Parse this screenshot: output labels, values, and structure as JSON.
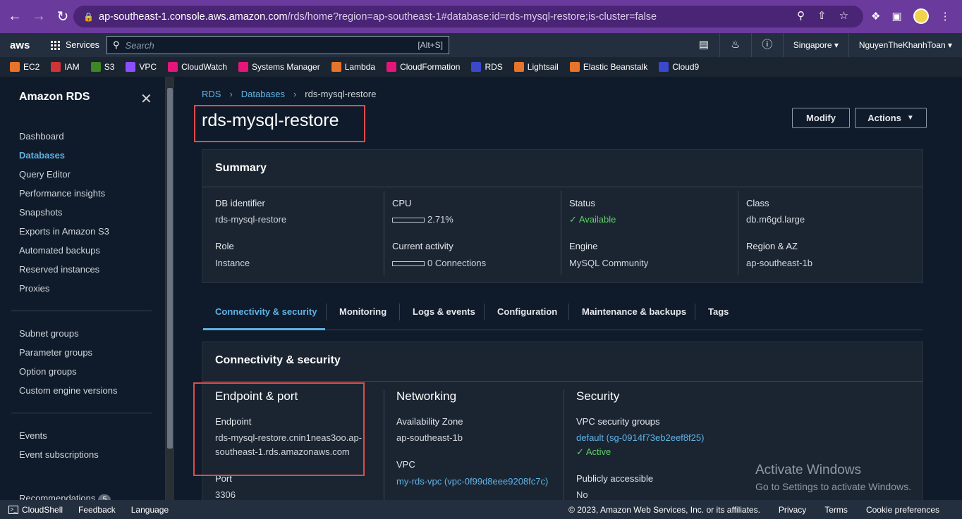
{
  "browser": {
    "url_domain": "ap-southeast-1.console.aws.amazon.com",
    "url_rest": "/rds/home?region=ap-southeast-1#database:id=rds-mysql-restore;is-cluster=false"
  },
  "aws_nav": {
    "logo": "aws",
    "services_label": "Services",
    "search_placeholder": "Search",
    "search_shortcut": "[Alt+S]",
    "region": "Singapore ▾",
    "user": "NguyenTheKhanhToan ▾"
  },
  "favorites": [
    {
      "label": "EC2",
      "color": "#e8742a"
    },
    {
      "label": "IAM",
      "color": "#d13434"
    },
    {
      "label": "S3",
      "color": "#3f8624"
    },
    {
      "label": "VPC",
      "color": "#8c4fff"
    },
    {
      "label": "CloudWatch",
      "color": "#e7157b"
    },
    {
      "label": "Systems Manager",
      "color": "#e7157b"
    },
    {
      "label": "Lambda",
      "color": "#e8742a"
    },
    {
      "label": "CloudFormation",
      "color": "#e7157b"
    },
    {
      "label": "RDS",
      "color": "#3b48cc"
    },
    {
      "label": "Lightsail",
      "color": "#e8742a"
    },
    {
      "label": "Elastic Beanstalk",
      "color": "#e8742a"
    },
    {
      "label": "Cloud9",
      "color": "#3b48cc"
    }
  ],
  "sidebar": {
    "title": "Amazon RDS",
    "items": [
      "Dashboard",
      "Databases",
      "Query Editor",
      "Performance insights",
      "Snapshots",
      "Exports in Amazon S3",
      "Automated backups",
      "Reserved instances",
      "Proxies"
    ],
    "items2": [
      "Subnet groups",
      "Parameter groups",
      "Option groups",
      "Custom engine versions"
    ],
    "items3": [
      "Events",
      "Event subscriptions"
    ],
    "recommendations": "Recommendations",
    "recommendations_count": "5"
  },
  "breadcrumb": {
    "rds": "RDS",
    "databases": "Databases",
    "current": "rds-mysql-restore"
  },
  "page_title": "rds-mysql-restore",
  "buttons": {
    "modify": "Modify",
    "actions": "Actions"
  },
  "summary": {
    "heading": "Summary",
    "db_identifier_label": "DB identifier",
    "db_identifier": "rds-mysql-restore",
    "cpu_label": "CPU",
    "cpu_value": "2.71%",
    "cpu_fraction": 0.0271,
    "status_label": "Status",
    "status_value": "Available",
    "class_label": "Class",
    "class_value": "db.m6gd.large",
    "role_label": "Role",
    "role_value": "Instance",
    "activity_label": "Current activity",
    "activity_value": "0 Connections",
    "engine_label": "Engine",
    "engine_value": "MySQL Community",
    "region_label": "Region & AZ",
    "region_value": "ap-southeast-1b"
  },
  "tabs": [
    "Connectivity & security",
    "Monitoring",
    "Logs & events",
    "Configuration",
    "Maintenance & backups",
    "Tags"
  ],
  "connectivity": {
    "heading": "Connectivity & security",
    "endpoint_section": "Endpoint & port",
    "endpoint_label": "Endpoint",
    "endpoint_line1": "rds-mysql-restore.cnin1neas3oo.ap-",
    "endpoint_line2": "southeast-1.rds.amazonaws.com",
    "port_label": "Port",
    "port_value": "3306",
    "networking_section": "Networking",
    "az_label": "Availability Zone",
    "az_value": "ap-southeast-1b",
    "vpc_label": "VPC",
    "vpc_value": "my-rds-vpc (vpc-0f99d8eee9208fc7c)",
    "security_section": "Security",
    "sg_label": "VPC security groups",
    "sg_value": "default (sg-0914f73eb2eef8f25)",
    "sg_status": "Active",
    "public_label": "Publicly accessible",
    "public_value": "No"
  },
  "watermark": {
    "line1": "Activate Windows",
    "line2": "Go to Settings to activate Windows."
  },
  "footer": {
    "cloudshell": "CloudShell",
    "feedback": "Feedback",
    "language": "Language",
    "copyright": "© 2023, Amazon Web Services, Inc. or its affiliates.",
    "privacy": "Privacy",
    "terms": "Terms",
    "cookies": "Cookie preferences"
  }
}
